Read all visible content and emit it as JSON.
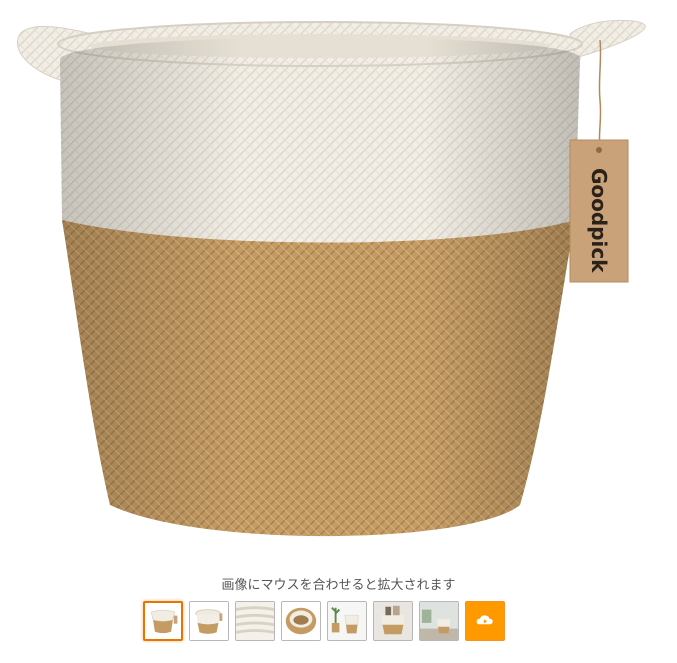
{
  "product": {
    "brand_tag": "Goodpick"
  },
  "hint": {
    "text": "画像にマウスを合わせると拡大されます"
  },
  "thumbnails": [
    {
      "name": "basket-front"
    },
    {
      "name": "basket-lid-side"
    },
    {
      "name": "rope-texture"
    },
    {
      "name": "basket-top-view"
    },
    {
      "name": "basket-with-plant"
    },
    {
      "name": "basket-with-items"
    },
    {
      "name": "basket-in-room"
    }
  ],
  "video_thumbnail": {
    "icon": "cloud-play-icon",
    "color": "#ff9900"
  },
  "colors": {
    "basket_white": "#f3efe6",
    "basket_jute": "#c9a26b",
    "tag": "#c9a27a",
    "selected_border": "#e77600"
  }
}
